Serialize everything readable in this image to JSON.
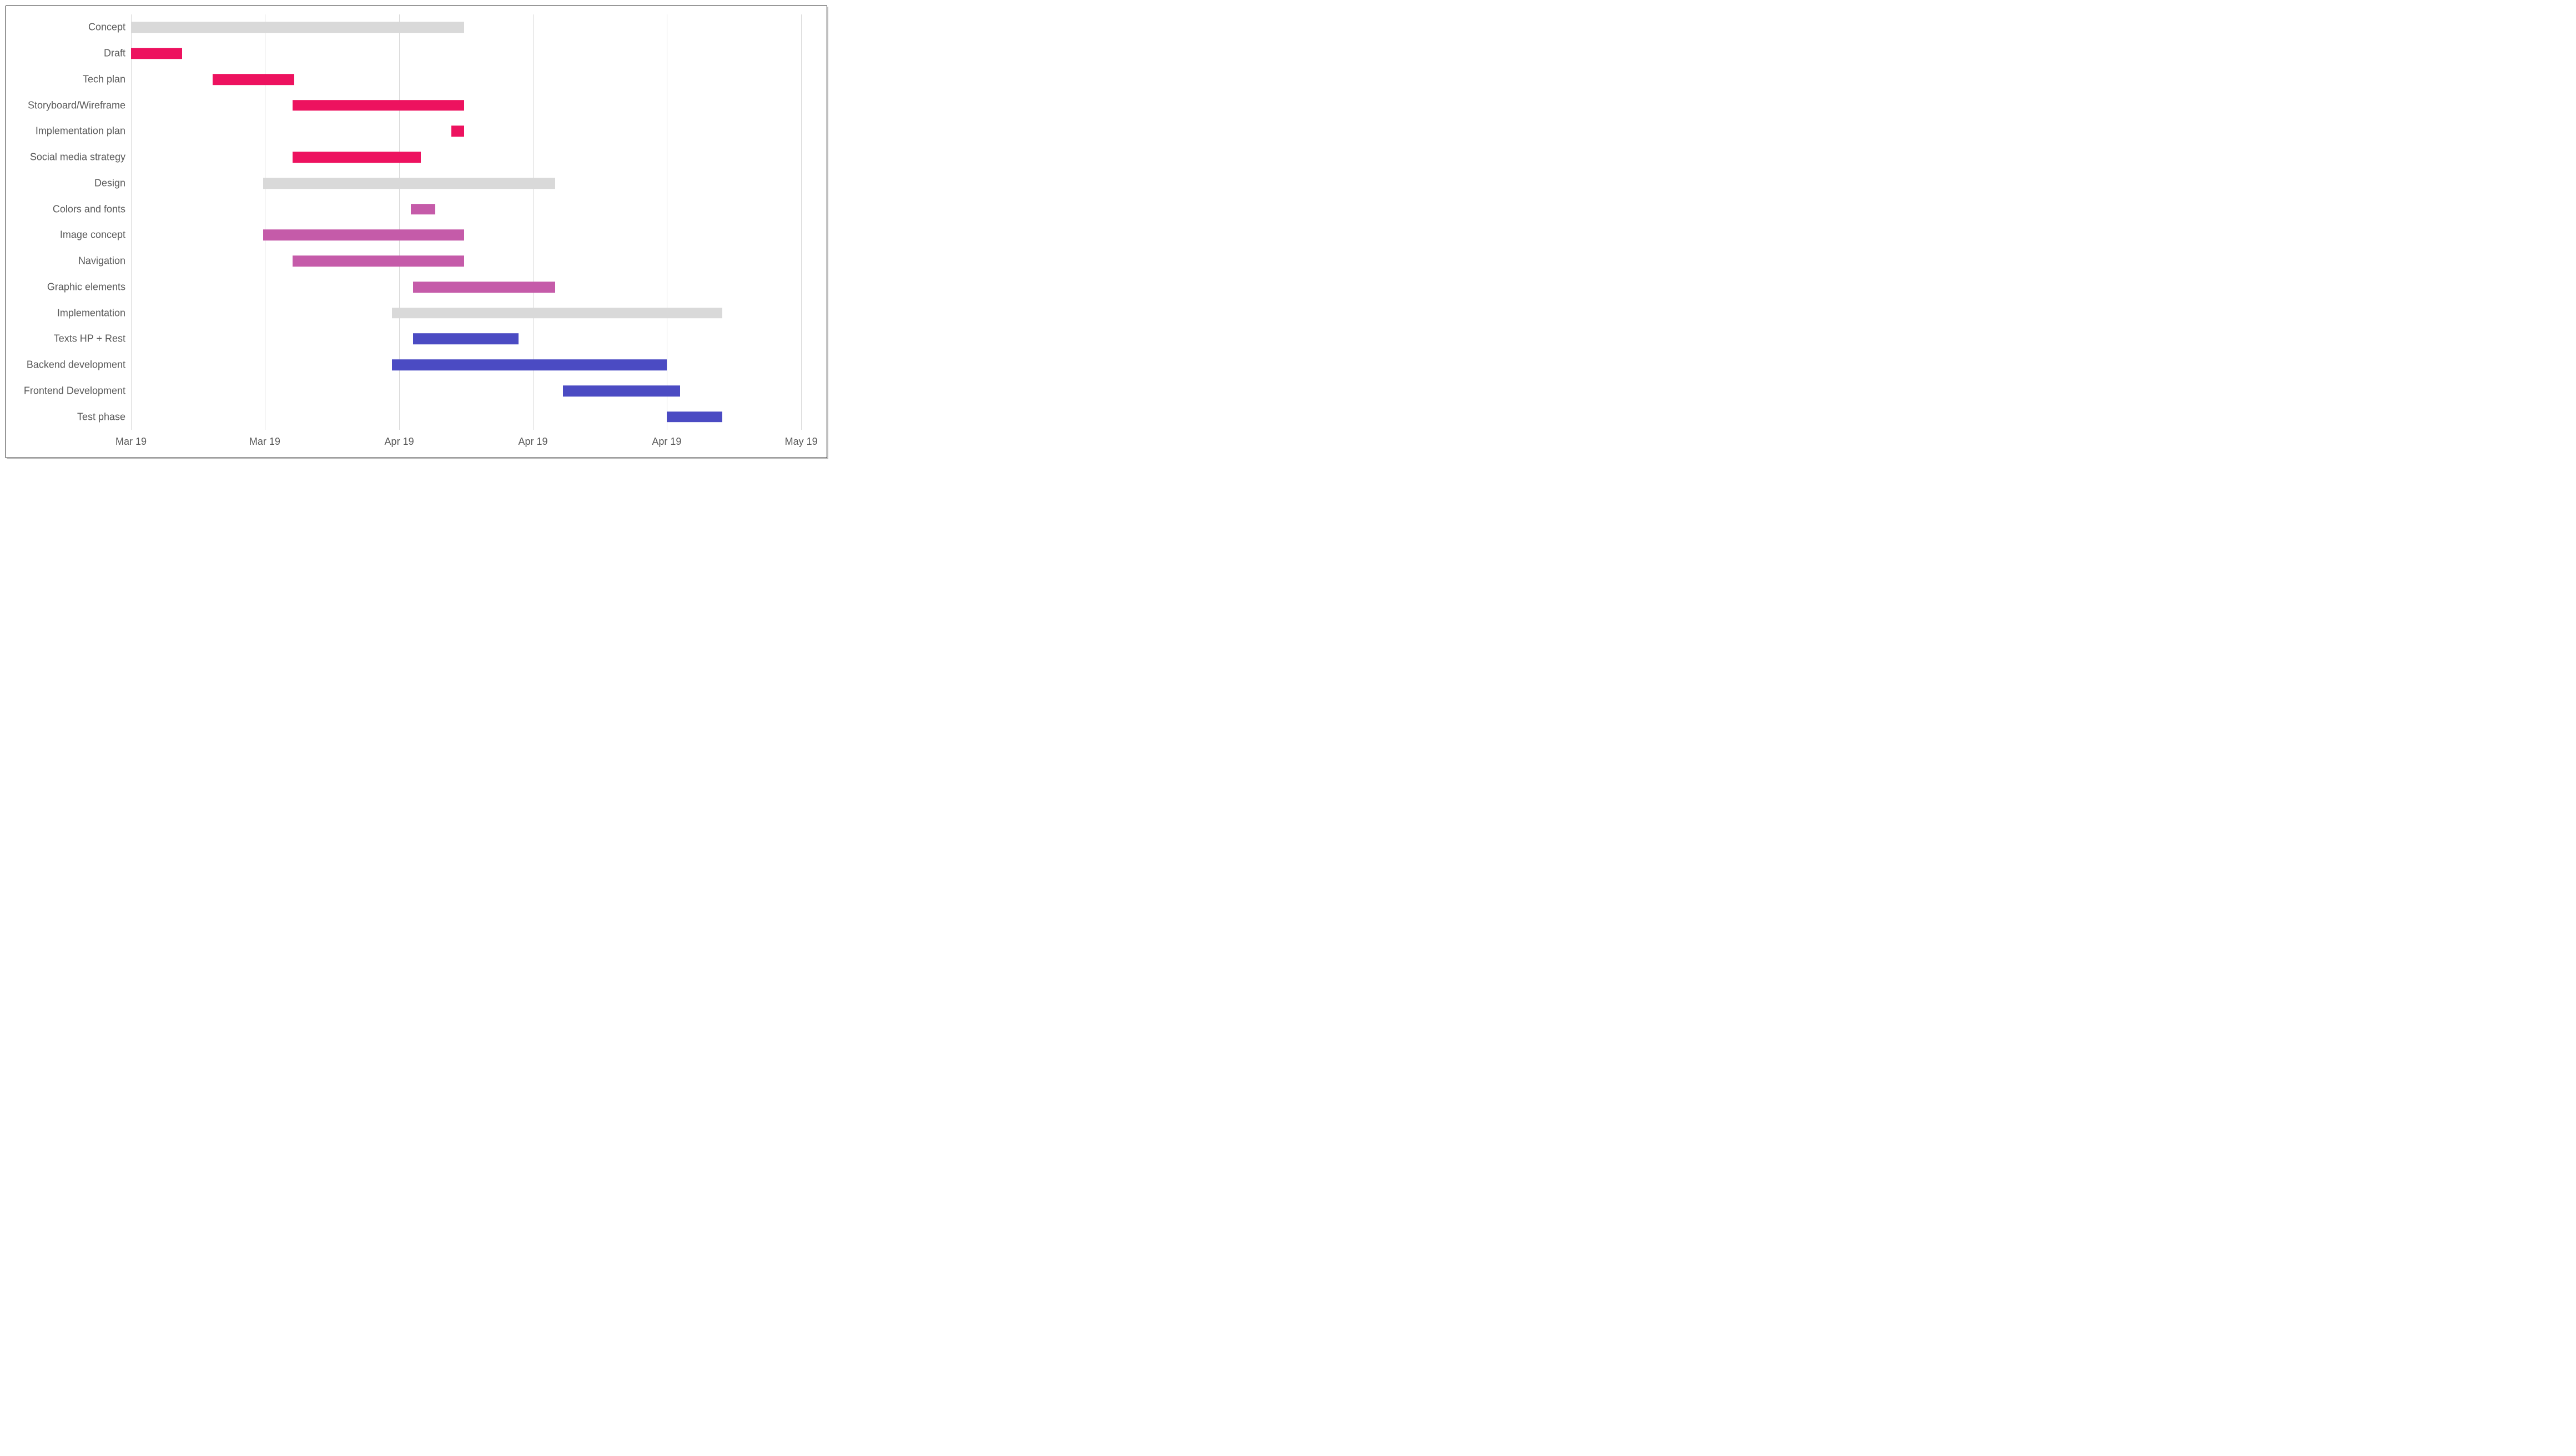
{
  "chart_data": {
    "type": "gantt",
    "x_axis": {
      "ticks": [
        {
          "pos": 0.0,
          "label": "Mar 19"
        },
        {
          "pos": 0.197,
          "label": "Mar 19"
        },
        {
          "pos": 0.395,
          "label": "Apr 19"
        },
        {
          "pos": 0.592,
          "label": "Apr 19"
        },
        {
          "pos": 0.789,
          "label": "Apr 19"
        },
        {
          "pos": 0.987,
          "label": "May 19"
        }
      ]
    },
    "rows": [
      {
        "label": "Concept",
        "color": "header",
        "start": 0.0,
        "end": 0.491
      },
      {
        "label": "Draft",
        "color": "concept",
        "start": 0.0,
        "end": 0.075
      },
      {
        "label": "Tech plan",
        "color": "concept",
        "start": 0.12,
        "end": 0.24
      },
      {
        "label": "Storyboard/Wireframe",
        "color": "concept",
        "start": 0.238,
        "end": 0.491
      },
      {
        "label": "Implementation plan",
        "color": "concept",
        "start": 0.472,
        "end": 0.491
      },
      {
        "label": "Social media strategy",
        "color": "concept",
        "start": 0.238,
        "end": 0.427
      },
      {
        "label": "Design",
        "color": "header",
        "start": 0.195,
        "end": 0.625
      },
      {
        "label": "Colors and fonts",
        "color": "design",
        "start": 0.412,
        "end": 0.448
      },
      {
        "label": "Image concept",
        "color": "design",
        "start": 0.195,
        "end": 0.491
      },
      {
        "label": "Navigation",
        "color": "design",
        "start": 0.238,
        "end": 0.491
      },
      {
        "label": "Graphic elements",
        "color": "design",
        "start": 0.415,
        "end": 0.625
      },
      {
        "label": "Implementation",
        "color": "header",
        "start": 0.384,
        "end": 0.871
      },
      {
        "label": "Texts HP + Rest",
        "color": "impl",
        "start": 0.415,
        "end": 0.571
      },
      {
        "label": "Backend development",
        "color": "impl",
        "start": 0.384,
        "end": 0.789
      },
      {
        "label": "Frontend Development",
        "color": "impl",
        "start": 0.636,
        "end": 0.809
      },
      {
        "label": "Test phase",
        "color": "impl",
        "start": 0.789,
        "end": 0.871
      }
    ],
    "colors": {
      "header": "#d9d9d9",
      "concept": "#ed125f",
      "design": "#c55ba9",
      "impl": "#4b4bc3"
    }
  }
}
